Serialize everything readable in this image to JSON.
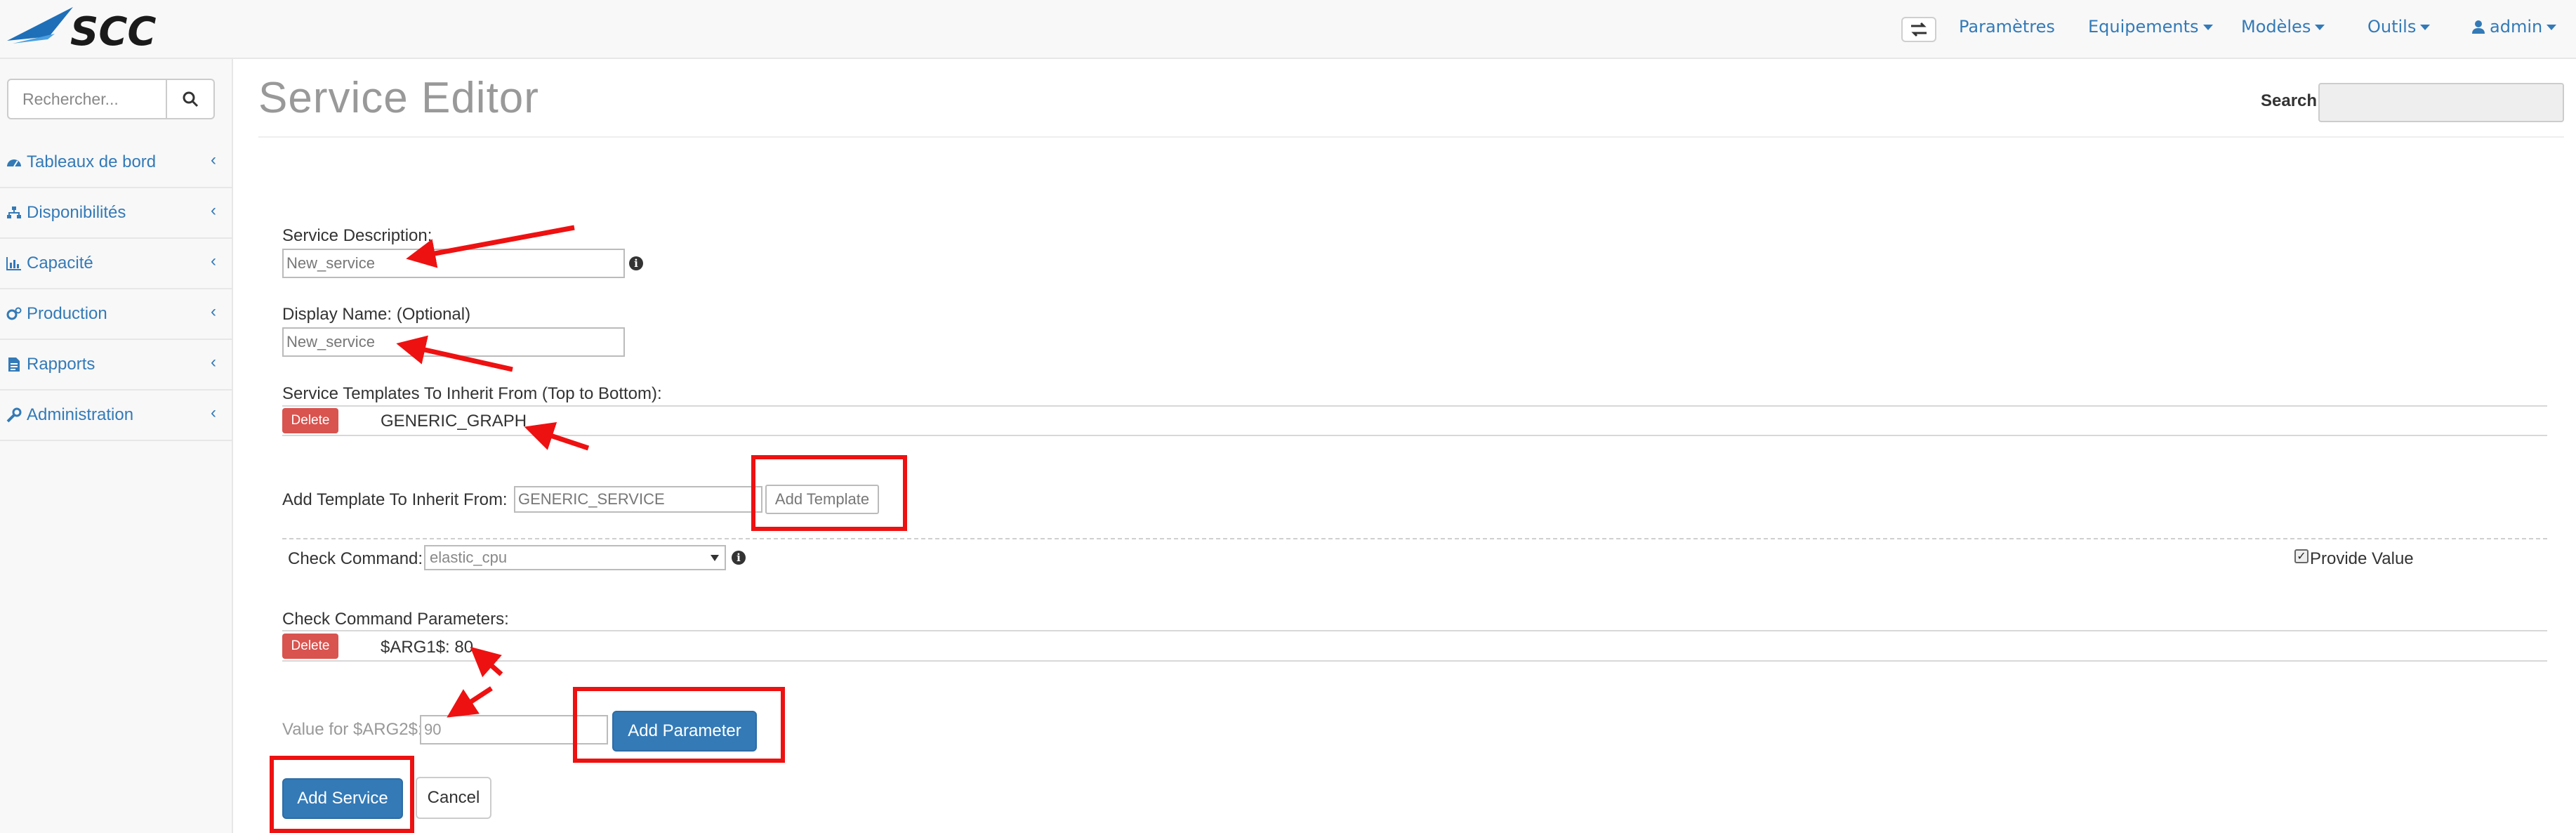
{
  "nav": {
    "logo_text": "SCC",
    "toggle_icon": "exchange-icon",
    "items": [
      {
        "label": "Paramètres",
        "has_caret": false
      },
      {
        "label": "Equipements",
        "has_caret": true
      },
      {
        "label": "Modèles",
        "has_caret": true
      },
      {
        "label": "Outils",
        "has_caret": true
      },
      {
        "label": "admin",
        "has_caret": true,
        "icon": "user-icon"
      }
    ]
  },
  "sidebar": {
    "search_placeholder": "Rechercher...",
    "items": [
      {
        "label": "Tableaux de bord",
        "icon": "dashboard-icon"
      },
      {
        "label": "Disponibilités",
        "icon": "sitemap-icon"
      },
      {
        "label": "Capacité",
        "icon": "bar-chart-icon"
      },
      {
        "label": "Production",
        "icon": "gears-icon"
      },
      {
        "label": "Rapports",
        "icon": "file-icon"
      },
      {
        "label": "Administration",
        "icon": "wrench-icon"
      }
    ]
  },
  "main": {
    "title": "Service Editor",
    "search_label": "Search:",
    "search_value": "",
    "service_description": {
      "label": "Service Description:",
      "value": "New_service"
    },
    "display_name": {
      "label": "Display Name: (Optional)",
      "value": "New_service"
    },
    "templates": {
      "label": "Service Templates To Inherit From (Top to Bottom):",
      "delete_label": "Delete",
      "entries": [
        "GENERIC_GRAPH"
      ]
    },
    "add_template": {
      "label": "Add Template To Inherit From:",
      "value": "GENERIC_SERVICE",
      "button_label": "Add Template"
    },
    "check_command": {
      "label": "Check Command:",
      "value": "elastic_cpu",
      "provide_value_label": "Provide Value",
      "provide_value_checked": true
    },
    "parameters": {
      "label": "Check Command Parameters:",
      "delete_label": "Delete",
      "entries": [
        "$ARG1$: 80"
      ]
    },
    "new_parameter": {
      "label": "Value for $ARG2$:",
      "value": "90",
      "button_label": "Add Parameter"
    },
    "actions": {
      "add_service_label": "Add Service",
      "cancel_label": "Cancel"
    }
  },
  "colors": {
    "accent": "#337ab7",
    "danger": "#d9534f",
    "annotation": "#ee1111"
  }
}
